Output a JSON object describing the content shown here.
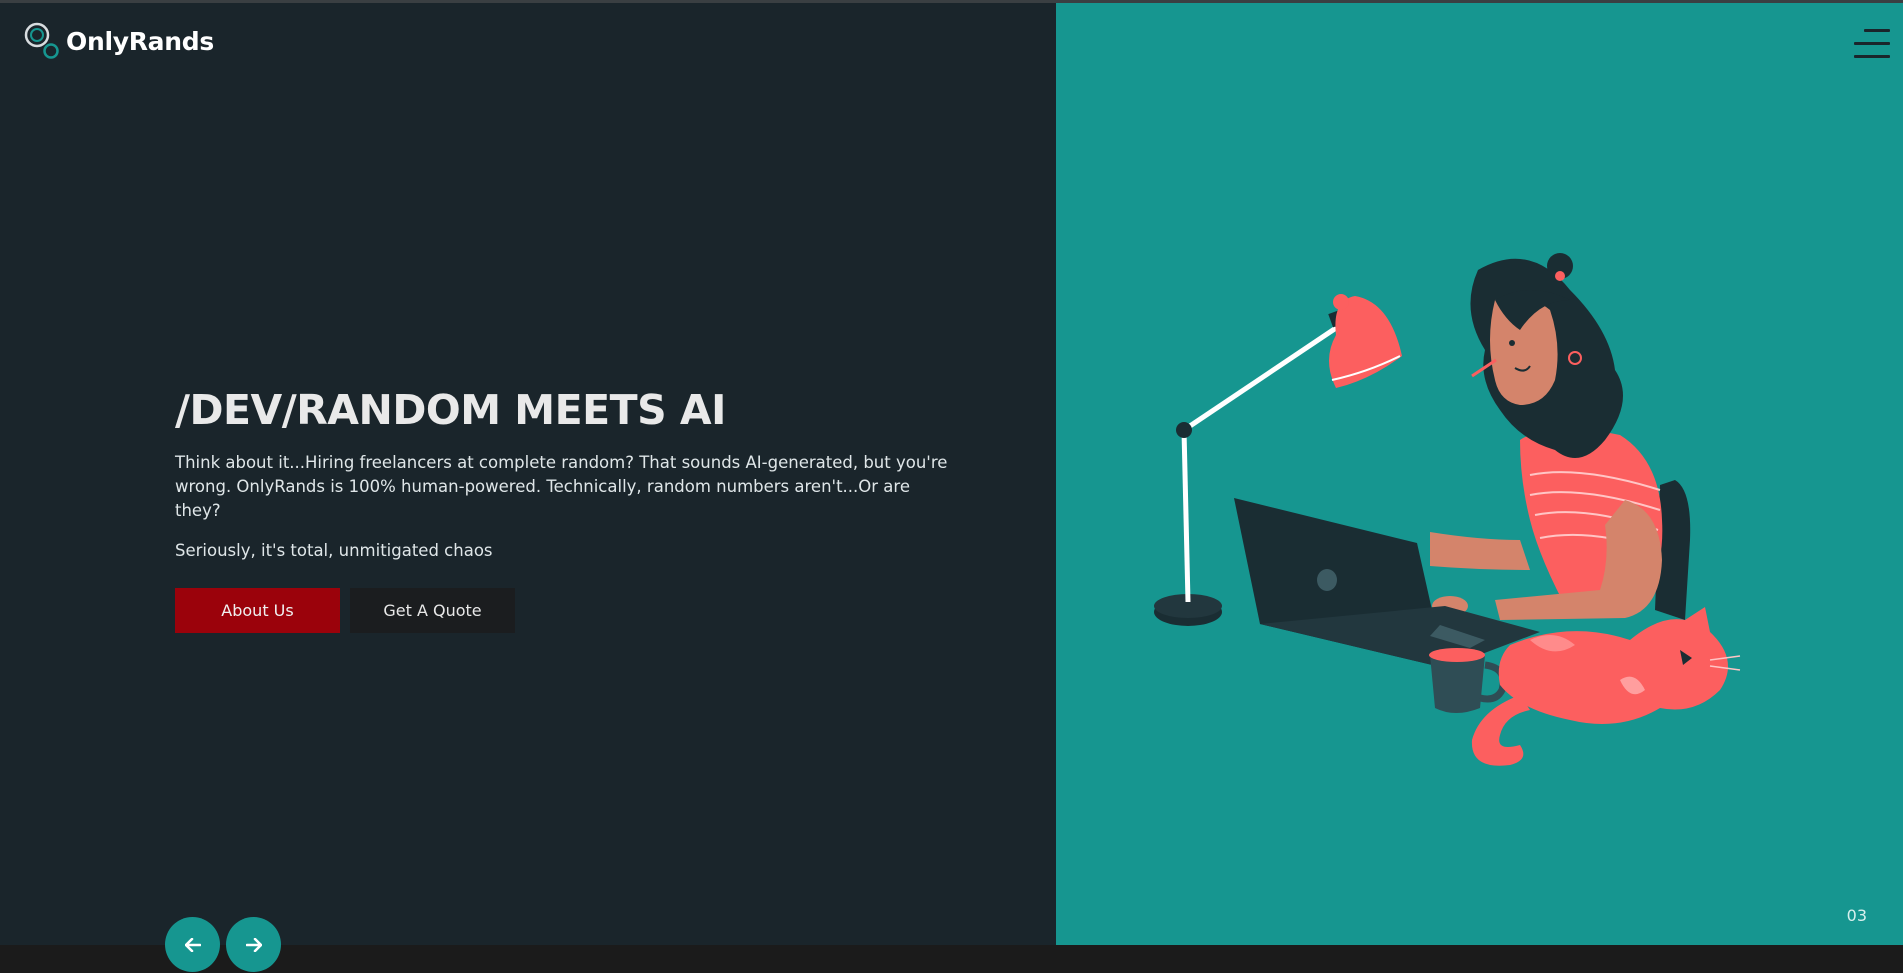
{
  "brand": {
    "name": "OnlyRands"
  },
  "hero": {
    "title": "/DEV/RANDOM MEETS AI",
    "description": "Think about it...Hiring freelancers at complete random? That sounds AI-generated, but you're wrong. OnlyRands is 100% human-powered. Technically, random numbers aren't...Or are they?",
    "subtext": "Seriously, it's total, unmitigated chaos"
  },
  "actions": {
    "about_label": "About Us",
    "quote_label": "Get A Quote"
  },
  "slider": {
    "current": "03"
  },
  "icons": {
    "logo": "logo-rings-icon",
    "menu": "hamburger-menu-icon",
    "prev": "arrow-left-icon",
    "next": "arrow-right-icon"
  },
  "colors": {
    "left_panel": "#1a252b",
    "right_panel": "#169690",
    "primary_button": "#9b020b",
    "secondary_button": "#1b1d1f",
    "accent": "#169690",
    "coral": "#fc5f5f"
  }
}
